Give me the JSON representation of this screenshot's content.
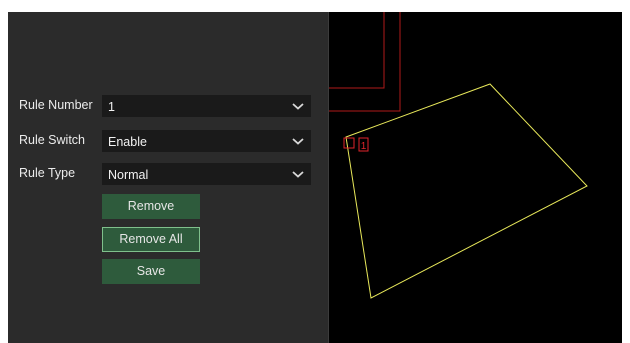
{
  "settings": {
    "rule_number": {
      "label": "Rule Number",
      "value": "1"
    },
    "rule_switch": {
      "label": "Rule Switch",
      "value": "Enable"
    },
    "rule_type": {
      "label": "Rule Type",
      "value": "Normal"
    }
  },
  "buttons": {
    "remove": "Remove",
    "remove_all": "Remove All",
    "save": "Save"
  },
  "canvas": {
    "region_label": "1",
    "colors": {
      "region_line": "#e8e85a",
      "region_marker": "#e0252b",
      "background_lines": "#b01a1a",
      "button_fill": "#2e5b3c",
      "button_focus_border": "#7fc08c"
    }
  }
}
